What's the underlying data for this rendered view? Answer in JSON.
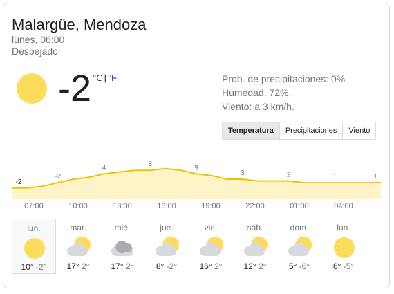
{
  "location": "Malargüe, Mendoza",
  "datetime": "lunes, 06:00",
  "condition": "Despejado",
  "current": {
    "temp": "-2",
    "unit_c": "°C",
    "unit_sep": "|",
    "unit_f": "°F",
    "icon": "sun-icon"
  },
  "details": {
    "precip": "Prob. de precipitaciones: 0%",
    "humidity": "Humedad: 72%.",
    "wind": "Viento: a 3 km/h."
  },
  "tabs": [
    {
      "label": "Temperatura",
      "active": true
    },
    {
      "label": "Precipitaciones",
      "active": false
    },
    {
      "label": "Viento",
      "active": false
    }
  ],
  "colors": {
    "sun": "#fddc5c",
    "chart_line": "#f2c200",
    "chart_fill": "#fff4c7",
    "unit_link": "#1a0dab"
  },
  "chart_data": {
    "type": "area",
    "x": [
      "07:00",
      "10:00",
      "13:00",
      "16:00",
      "19:00",
      "22:00",
      "01:00",
      "04:00"
    ],
    "labeled_values": [
      -2,
      -2,
      4,
      8,
      9,
      3,
      2,
      1,
      1
    ],
    "values": [
      -2,
      -2,
      -1,
      1,
      3,
      4,
      6,
      7,
      8,
      8,
      9,
      8,
      6,
      5,
      3,
      3,
      2,
      2,
      2,
      1,
      1,
      1,
      1,
      1,
      1
    ],
    "grid": false,
    "legend": "none"
  },
  "hours": [
    "07:00",
    "10:00",
    "13:00",
    "16:00",
    "19:00",
    "22:00",
    "01:00",
    "04:00"
  ],
  "days": [
    {
      "name": "lun.",
      "icon": "sun-icon",
      "hi": "10°",
      "lo": "-2°",
      "selected": true
    },
    {
      "name": "mar.",
      "icon": "partly-cloudy-icon",
      "hi": "17°",
      "lo": "2°",
      "selected": false
    },
    {
      "name": "mié.",
      "icon": "cloudy-icon",
      "hi": "17°",
      "lo": "2°",
      "selected": false
    },
    {
      "name": "jue.",
      "icon": "partly-cloudy-icon",
      "hi": "8°",
      "lo": "-2°",
      "selected": false
    },
    {
      "name": "vie.",
      "icon": "partly-cloudy-icon",
      "hi": "16°",
      "lo": "2°",
      "selected": false
    },
    {
      "name": "sáb.",
      "icon": "partly-cloudy-icon",
      "hi": "12°",
      "lo": "2°",
      "selected": false
    },
    {
      "name": "dom.",
      "icon": "partly-cloudy-icon",
      "hi": "5°",
      "lo": "-6°",
      "selected": false
    },
    {
      "name": "lun.",
      "icon": "sun-icon",
      "hi": "6°",
      "lo": "-5°",
      "selected": false
    }
  ]
}
